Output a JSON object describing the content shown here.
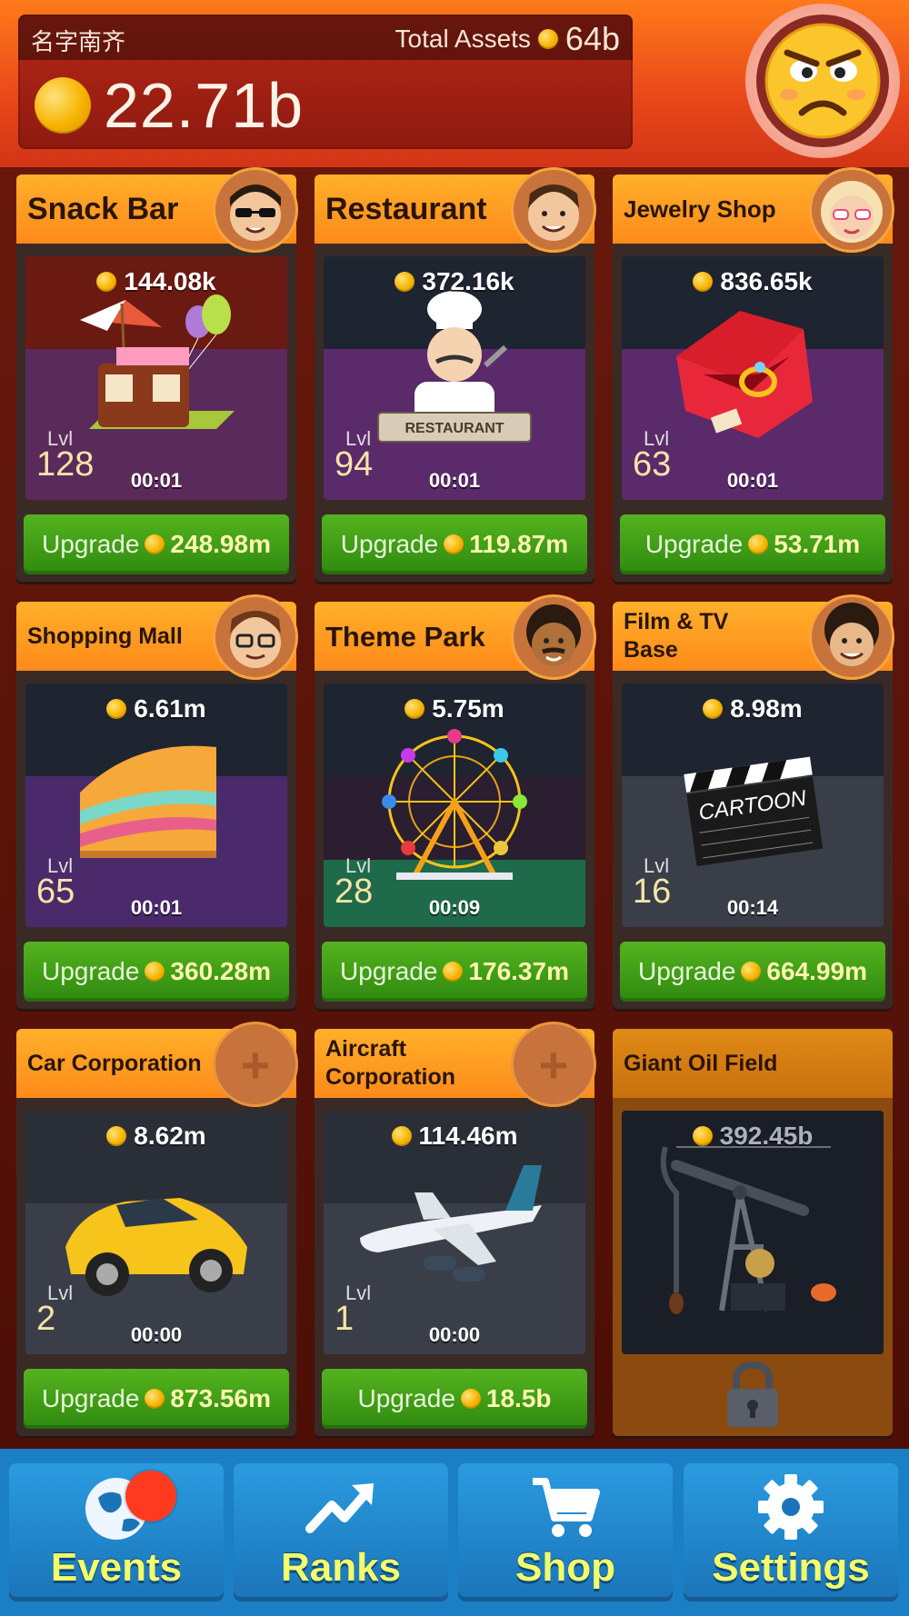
{
  "header": {
    "player_name": "名字南齐",
    "total_assets_label": "Total Assets",
    "total_assets_value": "64b",
    "balance": "22.71b"
  },
  "businesses": [
    {
      "title": "Snack Bar",
      "income": "144.08k",
      "level_label": "Lvl",
      "level": "128",
      "timer": "00:01",
      "upgrade_label": "Upgrade",
      "upgrade_cost": "248.98m"
    },
    {
      "title": "Restaurant",
      "income": "372.16k",
      "level_label": "Lvl",
      "level": "94",
      "timer": "00:01",
      "upgrade_label": "Upgrade",
      "upgrade_cost": "119.87m"
    },
    {
      "title": "Jewelry Shop",
      "income": "836.65k",
      "level_label": "Lvl",
      "level": "63",
      "timer": "00:01",
      "upgrade_label": "Upgrade",
      "upgrade_cost": "53.71m"
    },
    {
      "title": "Shopping Mall",
      "income": "6.61m",
      "level_label": "Lvl",
      "level": "65",
      "timer": "00:01",
      "upgrade_label": "Upgrade",
      "upgrade_cost": "360.28m"
    },
    {
      "title": "Theme Park",
      "income": "5.75m",
      "level_label": "Lvl",
      "level": "28",
      "timer": "00:09",
      "upgrade_label": "Upgrade",
      "upgrade_cost": "176.37m"
    },
    {
      "title": "Film & TV Base",
      "income": "8.98m",
      "level_label": "Lvl",
      "level": "16",
      "timer": "00:14",
      "upgrade_label": "Upgrade",
      "upgrade_cost": "664.99m"
    },
    {
      "title": "Car Corporation",
      "income": "8.62m",
      "level_label": "Lvl",
      "level": "2",
      "timer": "00:00",
      "upgrade_label": "Upgrade",
      "upgrade_cost": "873.56m"
    },
    {
      "title": "Aircraft Corporation",
      "income": "114.46m",
      "level_label": "Lvl",
      "level": "1",
      "timer": "00:00",
      "upgrade_label": "Upgrade",
      "upgrade_cost": "18.5b"
    },
    {
      "title": "Giant Oil Field",
      "unlock_cost": "392.45b",
      "locked": true
    }
  ],
  "clapper_text": "CARTOON",
  "sign_text": "RESTAURANT",
  "nav": [
    {
      "label": "Events",
      "icon": "globe-icon",
      "has_badge": true
    },
    {
      "label": "Ranks",
      "icon": "trend-up-icon"
    },
    {
      "label": "Shop",
      "icon": "cart-icon"
    },
    {
      "label": "Settings",
      "icon": "gear-icon"
    }
  ]
}
